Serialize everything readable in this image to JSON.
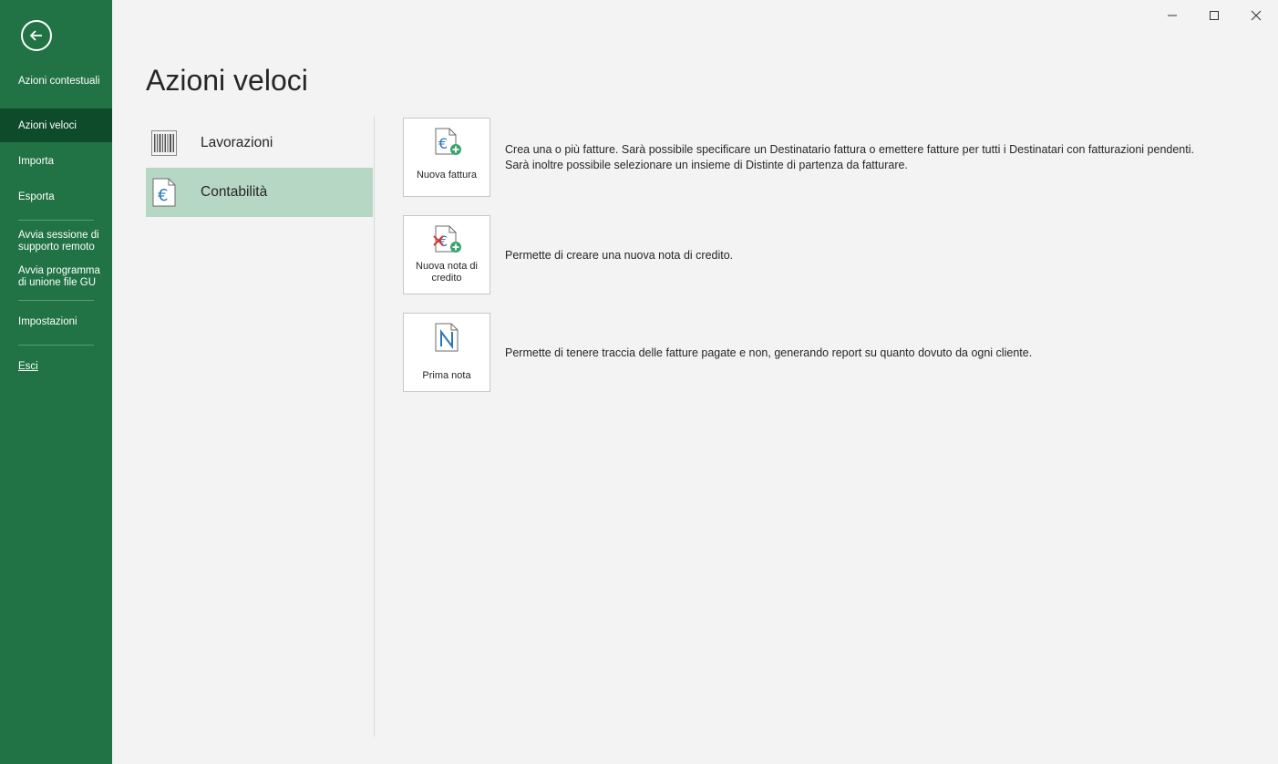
{
  "sidebar": {
    "back_icon": "arrow-left-icon",
    "items": [
      {
        "label": "Azioni contestuali"
      },
      {
        "label": "Azioni veloci",
        "active": true
      },
      {
        "label": "Importa"
      },
      {
        "label": "Esporta"
      },
      {
        "label": "Avvia sessione di supporto remoto"
      },
      {
        "label": "Avvia programma di unione file GU"
      },
      {
        "label": "Impostazioni"
      },
      {
        "label": "Esci"
      }
    ],
    "colors": {
      "background": "#217346",
      "active": "#0e4b2a"
    }
  },
  "window_controls": {
    "minimize": "minimize-icon",
    "maximize": "maximize-icon",
    "close": "close-icon"
  },
  "main": {
    "title": "Azioni veloci",
    "categories": [
      {
        "label": "Lavorazioni",
        "icon": "barcode-icon",
        "selected": false
      },
      {
        "label": "Contabilità",
        "icon": "euro-document-icon",
        "selected": true
      }
    ],
    "actions": [
      {
        "label": "Nuova fattura",
        "icon": "new-invoice-icon",
        "description": "Crea una o più fatture. Sarà possibile specificare un Destinatario fattura o emettere fatture per tutti i Destinatari con fatturazioni pendenti. Sarà inoltre possibile selezionare un insieme di Distinte di partenza da fatturare."
      },
      {
        "label": "Nuova nota di credito",
        "icon": "new-credit-note-icon",
        "description": "Permette di creare una nuova nota di credito."
      },
      {
        "label": "Prima nota",
        "icon": "prima-nota-icon",
        "description": "Permette di tenere traccia delle fatture pagate e non, generando report su quanto dovuto da ogni cliente."
      }
    ],
    "colors": {
      "selected_category": "#b7d7c5",
      "euro_blue": "#2e75b6",
      "plus_green": "#3aa36b",
      "cross_red": "#d9352a"
    }
  }
}
